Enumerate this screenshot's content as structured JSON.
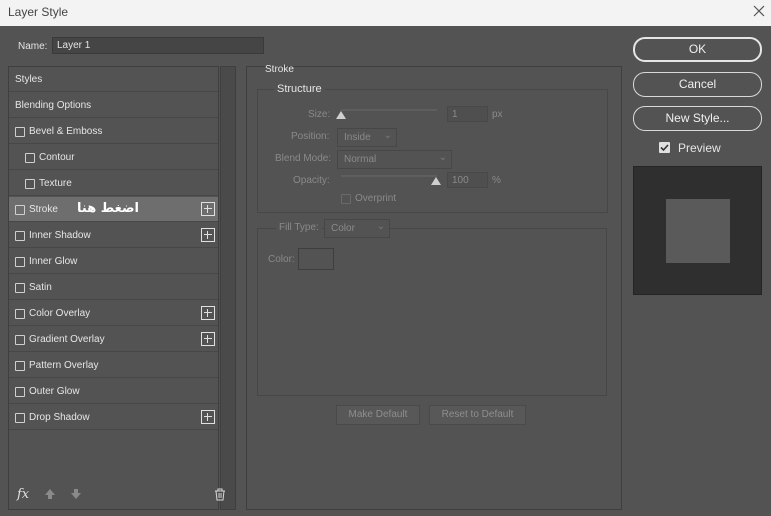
{
  "window": {
    "title": "Layer Style"
  },
  "name_field": {
    "label": "Name:",
    "value": "Layer 1"
  },
  "styles_list": {
    "header": "Styles",
    "items": [
      {
        "label": "Blending Options"
      },
      {
        "label": "Bevel & Emboss"
      },
      {
        "label": "Contour"
      },
      {
        "label": "Texture"
      },
      {
        "label": "Stroke",
        "annotation": "اضغط هنا"
      },
      {
        "label": "Inner Shadow"
      },
      {
        "label": "Inner Glow"
      },
      {
        "label": "Satin"
      },
      {
        "label": "Color Overlay"
      },
      {
        "label": "Gradient Overlay"
      },
      {
        "label": "Pattern Overlay"
      },
      {
        "label": "Outer Glow"
      },
      {
        "label": "Drop Shadow"
      }
    ]
  },
  "stroke_panel": {
    "title": "Stroke",
    "structure": {
      "title": "Structure",
      "size_label": "Size:",
      "size_value": "1",
      "size_unit": "px",
      "position_label": "Position:",
      "position_value": "Inside",
      "blend_mode_label": "Blend Mode:",
      "blend_mode_value": "Normal",
      "opacity_label": "Opacity:",
      "opacity_value": "100",
      "opacity_unit": "%",
      "overprint_label": "Overprint"
    },
    "fill": {
      "fill_type_label": "Fill Type:",
      "fill_type_value": "Color",
      "color_label": "Color:"
    },
    "make_default": "Make Default",
    "reset_default": "Reset to Default"
  },
  "buttons": {
    "ok": "OK",
    "cancel": "Cancel",
    "new_style": "New Style..."
  },
  "preview": {
    "label": "Preview",
    "checked": true
  }
}
